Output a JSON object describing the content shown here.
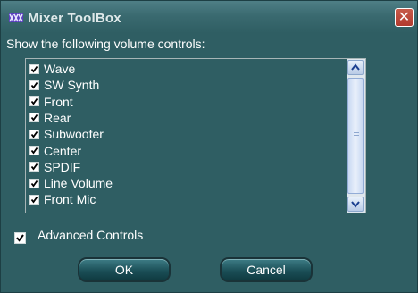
{
  "window": {
    "title": "Mixer ToolBox",
    "close_glyph": "✕",
    "app_icon": "mixer-app-icon",
    "colors": {
      "background": "#2f5e63",
      "close_button": "#c0473b"
    }
  },
  "prompt": "Show the following volume controls:",
  "controls": [
    {
      "label": "Wave",
      "checked": true
    },
    {
      "label": "SW Synth",
      "checked": true
    },
    {
      "label": "Front",
      "checked": true
    },
    {
      "label": "Rear",
      "checked": true
    },
    {
      "label": "Subwoofer",
      "checked": true
    },
    {
      "label": "Center",
      "checked": true
    },
    {
      "label": "SPDIF",
      "checked": true
    },
    {
      "label": "Line Volume",
      "checked": true
    },
    {
      "label": "Front Mic",
      "checked": true
    }
  ],
  "advanced_controls": {
    "label": "Advanced Controls",
    "checked": true
  },
  "buttons": {
    "ok": "OK",
    "cancel": "Cancel"
  }
}
